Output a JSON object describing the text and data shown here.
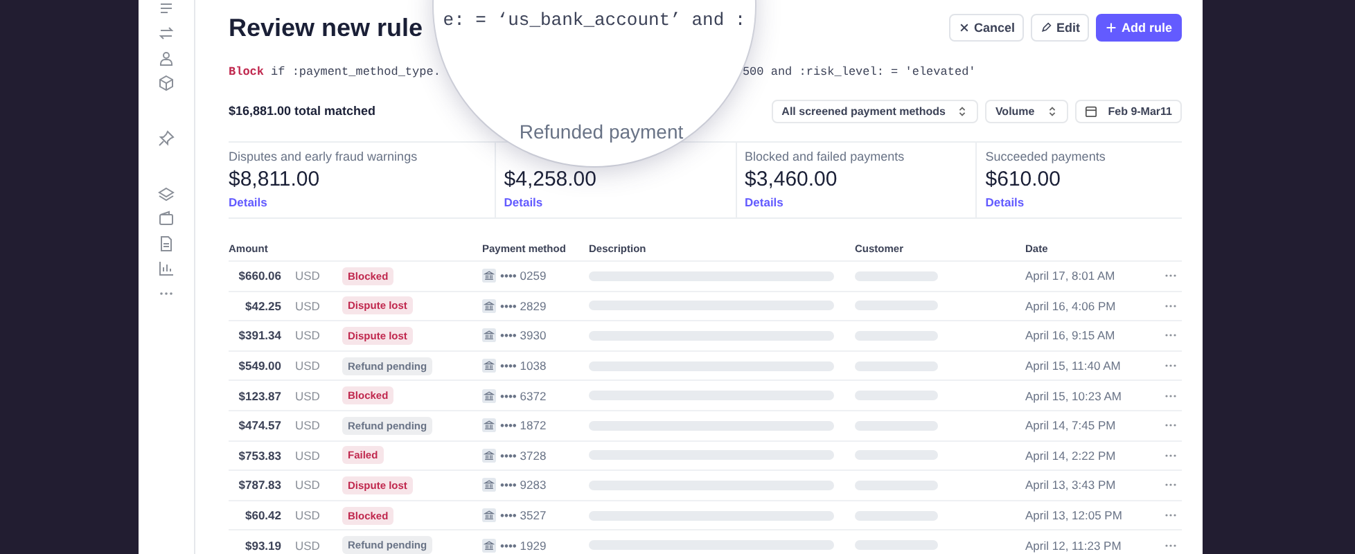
{
  "header": {
    "title": "Review new rule",
    "buttons": [
      {
        "label": "Cancel",
        "kind": "cancel"
      },
      {
        "label": "Edit",
        "kind": "edit"
      },
      {
        "label": "Add rule",
        "kind": "primary"
      }
    ]
  },
  "rule": {
    "action": "Block",
    "condition_start": "if :payment_method_type.",
    "condition_end": "500 and :risk_level: = 'elevated'"
  },
  "magnifier": {
    "code": "e: = ‘us_bank_account’ and :",
    "label": "Refunded payment"
  },
  "summary": {
    "total": "$16,881.00 total matched",
    "filters": [
      {
        "label": "All screened payment methods",
        "kind": "select"
      },
      {
        "label": "Volume",
        "kind": "select"
      },
      {
        "label": "Feb 9-Mar11",
        "kind": "date"
      }
    ]
  },
  "cards": [
    {
      "label": "Disputes and early fraud warnings",
      "value": "$8,811.00",
      "link": "Details"
    },
    {
      "value": "$4,258.00",
      "link": "Details"
    },
    {
      "label": "Blocked and failed payments",
      "value": "$3,460.00",
      "link": "Details"
    },
    {
      "label": "Succeeded payments",
      "value": "$610.00",
      "link": "Details"
    }
  ],
  "table": {
    "columns": [
      "Amount",
      "Payment method",
      "Description",
      "Customer",
      "Date"
    ],
    "rows": [
      {
        "amount": "$660.06",
        "currency": "USD",
        "status": {
          "label": "Blocked",
          "color": "#c0284e"
        },
        "card": "•••• 0259",
        "date": "April 17, 8:01 AM"
      },
      {
        "amount": "$42.25",
        "currency": "USD",
        "status": {
          "label": "Dispute lost",
          "color": "#c0284e"
        },
        "card": "•••• 2829",
        "date": "April 16, 4:06 PM"
      },
      {
        "amount": "$391.34",
        "currency": "USD",
        "status": {
          "label": "Dispute lost",
          "color": "#c0284e"
        },
        "card": "•••• 3930",
        "date": "April 16, 9:15 AM"
      },
      {
        "amount": "$549.00",
        "currency": "USD",
        "status": {
          "label": "Refund pending",
          "color": "#697386"
        },
        "card": "•••• 1038",
        "date": "April 15, 11:40 AM"
      },
      {
        "amount": "$123.87",
        "currency": "USD",
        "status": {
          "label": "Blocked",
          "color": "#c0284e"
        },
        "card": "•••• 6372",
        "date": "April 15, 10:23 AM"
      },
      {
        "amount": "$474.57",
        "currency": "USD",
        "status": {
          "label": "Refund pending",
          "color": "#697386"
        },
        "card": "•••• 1872",
        "date": "April 14, 7:45 PM"
      },
      {
        "amount": "$753.83",
        "currency": "USD",
        "status": {
          "label": "Failed",
          "color": "#c0284e"
        },
        "card": "•••• 3728",
        "date": "April 14, 2:22 PM"
      },
      {
        "amount": "$787.83",
        "currency": "USD",
        "status": {
          "label": "Dispute lost",
          "color": "#c0284e"
        },
        "card": "•••• 9283",
        "date": "April 13, 3:43 PM"
      },
      {
        "amount": "$60.42",
        "currency": "USD",
        "status": {
          "label": "Blocked",
          "color": "#c0284e"
        },
        "card": "•••• 3527",
        "date": "April 13, 12:05 PM"
      },
      {
        "amount": "$93.19",
        "currency": "USD",
        "status": {
          "label": "Refund pending",
          "color": "#697386"
        },
        "card": "•••• 1929",
        "date": "April 12, 11:23 PM"
      }
    ]
  }
}
